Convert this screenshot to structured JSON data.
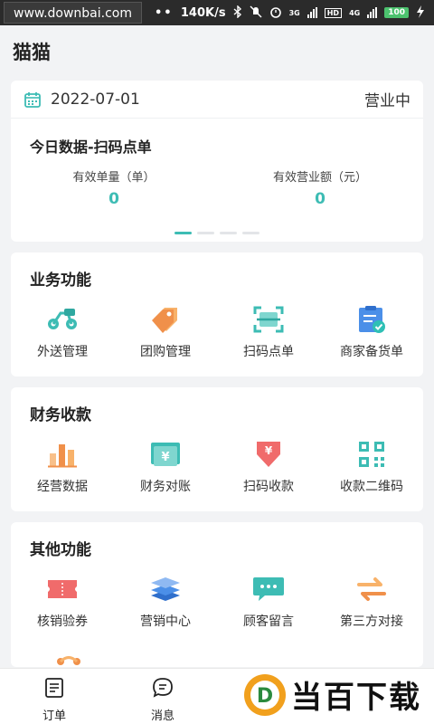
{
  "status_bar": {
    "site": "www.downbai.com",
    "dots": "••",
    "speed": "140K/s",
    "net_3g": "3G",
    "hd": "HD",
    "net_4g": "4G",
    "battery": "100"
  },
  "header": {
    "title": "猫猫"
  },
  "data_card": {
    "date": "2022-07-01",
    "status": "营业中",
    "title": "今日数据-扫码点单",
    "stats": [
      {
        "label": "有效单量（单）",
        "value": "0"
      },
      {
        "label": "有效营业额（元）",
        "value": "0"
      }
    ],
    "pager_count": 4,
    "pager_active": 0
  },
  "sections": [
    {
      "title": "业务功能",
      "items": [
        {
          "label": "外送管理",
          "icon": "scooter-icon"
        },
        {
          "label": "团购管理",
          "icon": "tag-icon"
        },
        {
          "label": "扫码点单",
          "icon": "scan-icon"
        },
        {
          "label": "商家备货单",
          "icon": "clipboard-check-icon"
        }
      ]
    },
    {
      "title": "财务收款",
      "items": [
        {
          "label": "经营数据",
          "icon": "bar-chart-icon"
        },
        {
          "label": "财务对账",
          "icon": "yuan-wallet-icon"
        },
        {
          "label": "扫码收款",
          "icon": "yuan-down-icon"
        },
        {
          "label": "收款二维码",
          "icon": "qrcode-icon"
        }
      ]
    },
    {
      "title": "其他功能",
      "items": [
        {
          "label": "核销验券",
          "icon": "ticket-icon"
        },
        {
          "label": "营销中心",
          "icon": "layers-icon"
        },
        {
          "label": "顾客留言",
          "icon": "chat-bubble-icon"
        },
        {
          "label": "第三方对接",
          "icon": "swap-icon"
        }
      ]
    }
  ],
  "bottom_nav": [
    {
      "label": "订单",
      "icon": "order-list-icon"
    },
    {
      "label": "消息",
      "icon": "message-icon"
    }
  ],
  "watermark": {
    "text": "当百下载",
    "letter": "D"
  },
  "colors": {
    "accent": "#3dbcb4",
    "page_bg": "#f2f3f5"
  }
}
